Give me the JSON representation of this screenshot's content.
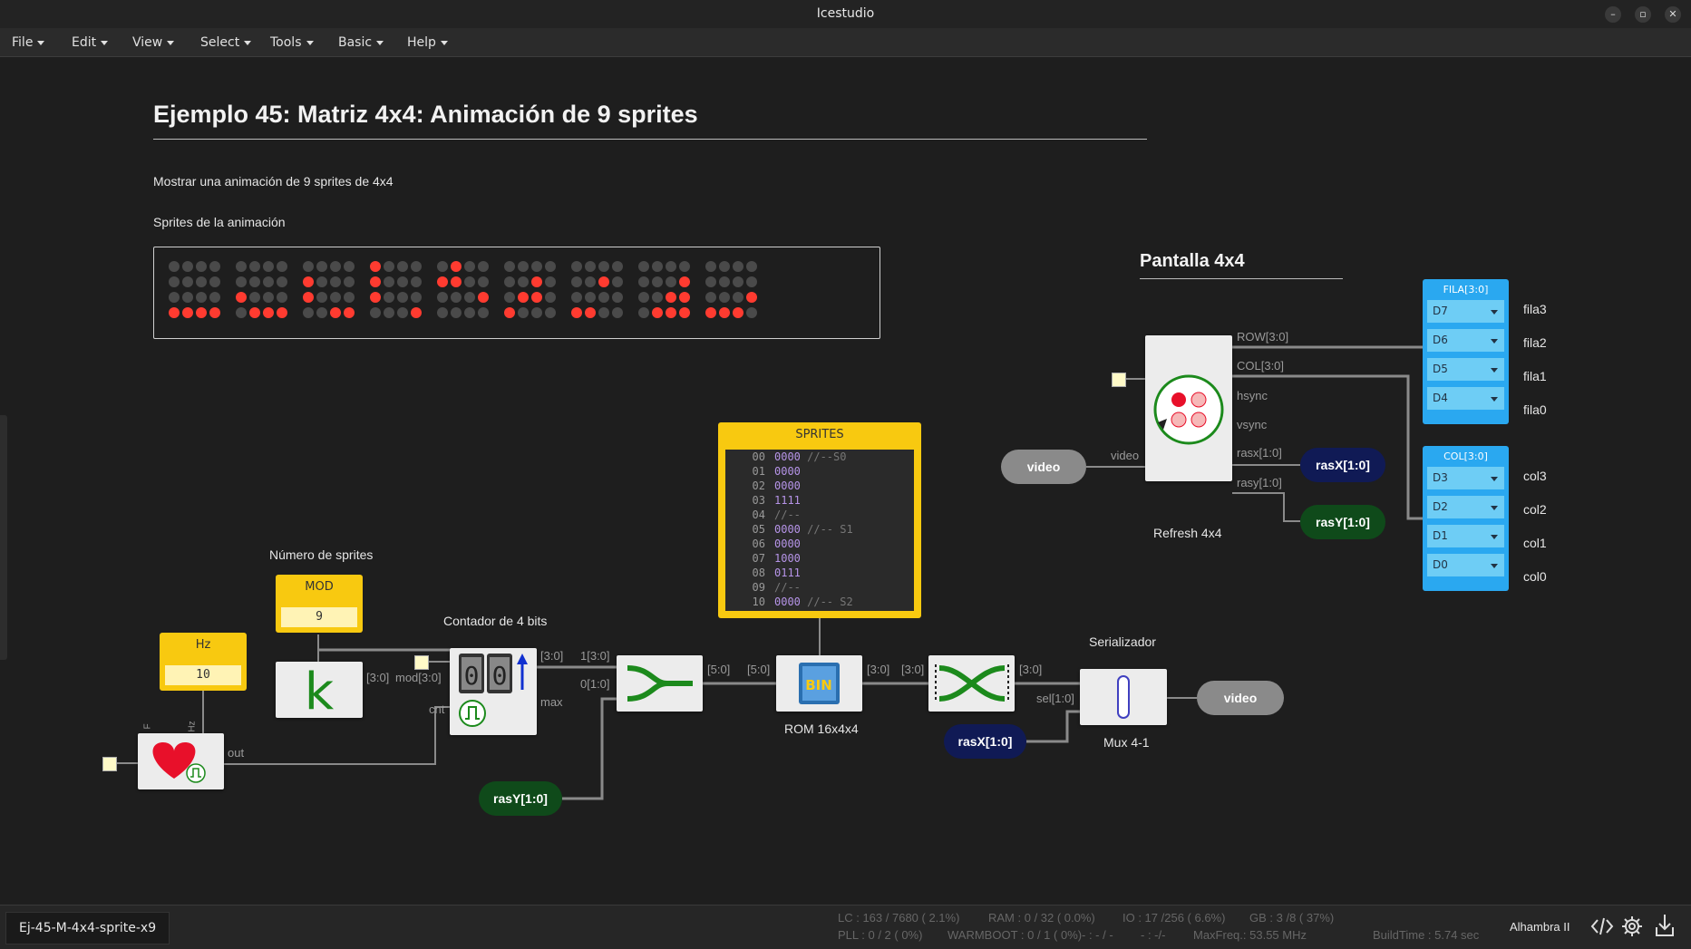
{
  "window": {
    "title": "Icestudio"
  },
  "menu": [
    "File",
    "Edit",
    "View",
    "Select",
    "Tools",
    "Basic",
    "Help"
  ],
  "document": {
    "title": "Ejemplo 45: Matriz 4x4: Animación de 9 sprites",
    "description": "Mostrar una animación de 9 sprites de 4x4",
    "sprites_caption": "Sprites de la animación",
    "screen_caption": "Pantalla 4x4",
    "sprites": [
      [
        "0000",
        "0000",
        "0000",
        "1111"
      ],
      [
        "0000",
        "0000",
        "1000",
        "0111"
      ],
      [
        "0000",
        "1000",
        "1000",
        "0011"
      ],
      [
        "1000",
        "1000",
        "1000",
        "0001"
      ],
      [
        "0100",
        "1100",
        "0001",
        "0000"
      ],
      [
        "0000",
        "0010",
        "0110",
        "1000"
      ],
      [
        "0000",
        "0010",
        "0000",
        "1100"
      ],
      [
        "0000",
        "0001",
        "0011",
        "0111"
      ],
      [
        "0000",
        "0000",
        "0001",
        "1110"
      ]
    ]
  },
  "blocks": {
    "hz": {
      "label": "Hz",
      "value": "10",
      "port_f": "F",
      "port_hz": "Hz",
      "out": "out"
    },
    "mod": {
      "caption": "Número de sprites",
      "label": "MOD",
      "value": "9",
      "out": "[3:0]"
    },
    "counter": {
      "caption": "Contador de 4 bits",
      "in_mod": "mod[3:0]",
      "in_cnt": "cnt",
      "out_bus": "[3:0]",
      "out_max": "max"
    },
    "join": {
      "in1": "1[3:0]",
      "in0": "0[1:0]",
      "out": "[5:0]"
    },
    "rom": {
      "caption": "ROM 16x4x4",
      "in": "[5:0]",
      "out": "[3:0]",
      "icon": "BIN"
    },
    "sprites_mem": {
      "title": "SPRITES",
      "rows": [
        {
          "n": "00",
          "v": "0000",
          "c": "//--S0"
        },
        {
          "n": "01",
          "v": "0000",
          "c": ""
        },
        {
          "n": "02",
          "v": "0000",
          "c": ""
        },
        {
          "n": "03",
          "v": "1111",
          "c": ""
        },
        {
          "n": "04",
          "v": "",
          "c": "//--"
        },
        {
          "n": "05",
          "v": "0000",
          "c": "//-- S1"
        },
        {
          "n": "06",
          "v": "0000",
          "c": ""
        },
        {
          "n": "07",
          "v": "1000",
          "c": ""
        },
        {
          "n": "08",
          "v": "0111",
          "c": ""
        },
        {
          "n": "09",
          "v": "",
          "c": "//--"
        },
        {
          "n": "10",
          "v": "0000",
          "c": "//-- S2"
        }
      ]
    },
    "split": {
      "in": "[3:0]",
      "out": "[3:0]"
    },
    "serializer": {
      "caption": "Serializador",
      "title": "Mux 4-1",
      "in_bus": "[3:0]",
      "in_sel": "sel[1:0]"
    },
    "refresh": {
      "caption": "Refresh 4x4",
      "in_video": "video",
      "ports": [
        "ROW[3:0]",
        "COL[3:0]",
        "hsync",
        "vsync",
        "rasx[1:0]",
        "rasy[1:0]"
      ]
    }
  },
  "labels": {
    "rasY_bottom": "rasY[1:0]",
    "rasX_bottom": "rasX[1:0]",
    "rasX_right": "rasX[1:0]",
    "rasY_right": "rasY[1:0]",
    "video_out": "video",
    "video_in": "video"
  },
  "outputs": {
    "fila": {
      "title": "FILA[3:0]",
      "pins": [
        "D7",
        "D6",
        "D5",
        "D4"
      ],
      "names": [
        "fila3",
        "fila2",
        "fila1",
        "fila0"
      ]
    },
    "col": {
      "title": "COL[3:0]",
      "pins": [
        "D3",
        "D2",
        "D1",
        "D0"
      ],
      "names": [
        "col3",
        "col2",
        "col1",
        "col0"
      ]
    }
  },
  "status": {
    "file": "Ej-45-M-4x4-sprite-x9",
    "lc": "LC : 163 / 7680 ( 2.1%)",
    "ram": "RAM : 0 / 32 ( 0.0%)",
    "io": "IO : 17 /256  ( 6.6%)",
    "gb": "GB : 3 /8  ( 37%)",
    "pll": "PLL : 0 / 2 ( 0%)",
    "warmboot": "WARMBOOT : 0 / 1 ( 0%)",
    "dash1": "- : - / -",
    "dash2": "- : -/-",
    "maxfreq": "MaxFreq.: 53.55 MHz",
    "buildtime": "BuildTime : 5.74 sec",
    "board": "Alhambra II"
  },
  "colors": {
    "accent_yellow": "#f8c910",
    "led_on": "#ff3b30",
    "led_off": "#4a4a4a",
    "bus_green": "#1c8a1c",
    "pin_blue": "#2aa8f0",
    "navy_label": "#101a55",
    "green_label": "#0f4a1a"
  }
}
